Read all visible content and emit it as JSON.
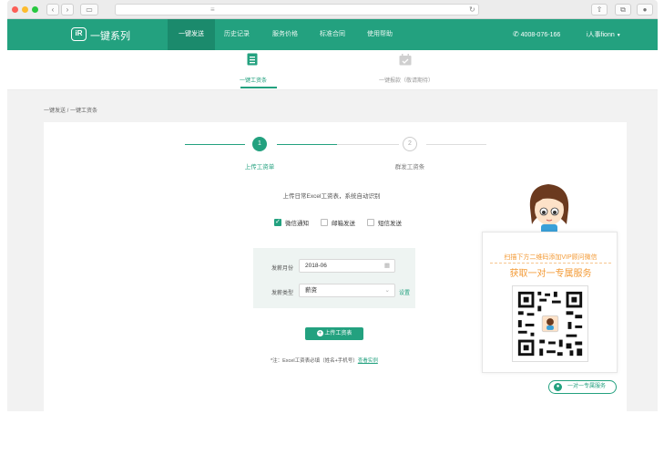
{
  "nav": {
    "logo": "一键系列",
    "logo_mark": "iR",
    "items": [
      "一键发送",
      "历史记录",
      "服务价格",
      "标准合同",
      "使用帮助"
    ],
    "phone": "4008-076-166",
    "user": "i人事fionn"
  },
  "subnav": {
    "tab1": "一键工资条",
    "tab2": "一键报款（敬请期待）"
  },
  "breadcrumb": "一键发送 / 一键工资条",
  "steps": [
    {
      "num": "1",
      "label": "上传工资单"
    },
    {
      "num": "2",
      "label": "群发工资条"
    }
  ],
  "upload_hint": "上传日常Excel工资表，系统自动识别",
  "channels": [
    {
      "label": "微信通知",
      "checked": true
    },
    {
      "label": "邮箱发送",
      "checked": false
    },
    {
      "label": "短信发送",
      "checked": false
    }
  ],
  "form": {
    "month_label": "发薪月份",
    "month_value": "2018-06",
    "type_label": "发薪类型",
    "type_value": "薪资",
    "settings_link": "设置"
  },
  "upload_button": "上传工资表",
  "note_prefix": "*注：Excel工资表必填（姓名+手机号）",
  "note_link": "查看实例",
  "promo": {
    "line1": "扫描下方二维码添加VIP顾问微信",
    "line2": "获取一对一专属服务",
    "button": "一对一专属服务"
  },
  "colors": {
    "primary": "#23a17f",
    "accent": "#f39a35"
  }
}
